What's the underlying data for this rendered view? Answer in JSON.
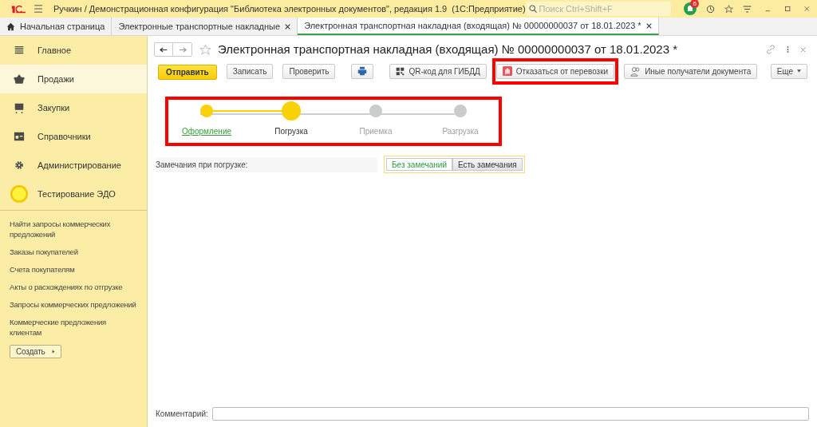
{
  "titlebar": {
    "title": "Ручкин / Демонстрационная конфигурация \"Библиотека электронных документов\", редакция 1.9  (1С:Предприятие)",
    "search_placeholder": "Поиск Ctrl+Shift+F",
    "notifications": "6"
  },
  "tabs": [
    {
      "label": "Начальная страница",
      "kind": "home",
      "selected": false
    },
    {
      "label": "Электронные транспортные накладные",
      "kind": "plain",
      "selected": false
    },
    {
      "label": "Электронная транспортная накладная (входящая) № 00000000037 от 18.01.2023 *",
      "kind": "plain",
      "selected": true
    }
  ],
  "sidebar": {
    "sections": [
      {
        "label": "Главное",
        "kind": "menu",
        "selected": false
      },
      {
        "label": "Продажи",
        "kind": "basket",
        "selected": true
      },
      {
        "label": "Закупки",
        "kind": "cart",
        "selected": false
      },
      {
        "label": "Справочники",
        "kind": "card",
        "selected": false
      },
      {
        "label": "Администрирование",
        "kind": "gear",
        "selected": false
      },
      {
        "label": "Тестирование ЭДО",
        "kind": "circle",
        "selected": false
      }
    ],
    "links": [
      "Найти запросы коммерческих предложений",
      "Заказы покупателей",
      "Счета покупателям",
      "Акты о расхождениях по отгрузке",
      "Запросы коммерческих предложений",
      "Коммерческие предложения клиентам"
    ],
    "create_button": "Создать"
  },
  "document": {
    "title": "Электронная транспортная накладная (входящая) № 00000000037 от 18.01.2023 *",
    "toolbar": [
      {
        "label": "Отправить",
        "kind": "primary",
        "highlighted": false
      },
      {
        "label": "Записать",
        "kind": "plain",
        "highlighted": false
      },
      {
        "label": "Проверить",
        "kind": "plain",
        "highlighted": false
      },
      {
        "kind": "print",
        "highlighted": false
      },
      {
        "label": "QR-код для ГИБДД",
        "kind": "qr",
        "highlighted": false
      },
      {
        "label": "Отказаться от перевозки",
        "kind": "refuse",
        "highlighted": true
      },
      {
        "label": "Иные получатели документа",
        "kind": "people",
        "highlighted": false
      }
    ],
    "more_button": "Еще",
    "steps": [
      {
        "label": "Оформление",
        "kind": "done"
      },
      {
        "label": "Погрузка",
        "kind": "current"
      },
      {
        "label": "Приемка",
        "kind": "pending"
      },
      {
        "label": "Разгрузка",
        "kind": "pending"
      }
    ],
    "steps_highlighted": true,
    "remarks_label": "Замечания при погрузке:",
    "remarks_options": [
      {
        "label": "Без замечаний",
        "selected": true
      },
      {
        "label": "Есть замечания",
        "selected": false
      }
    ],
    "comment_label": "Комментарий:"
  }
}
